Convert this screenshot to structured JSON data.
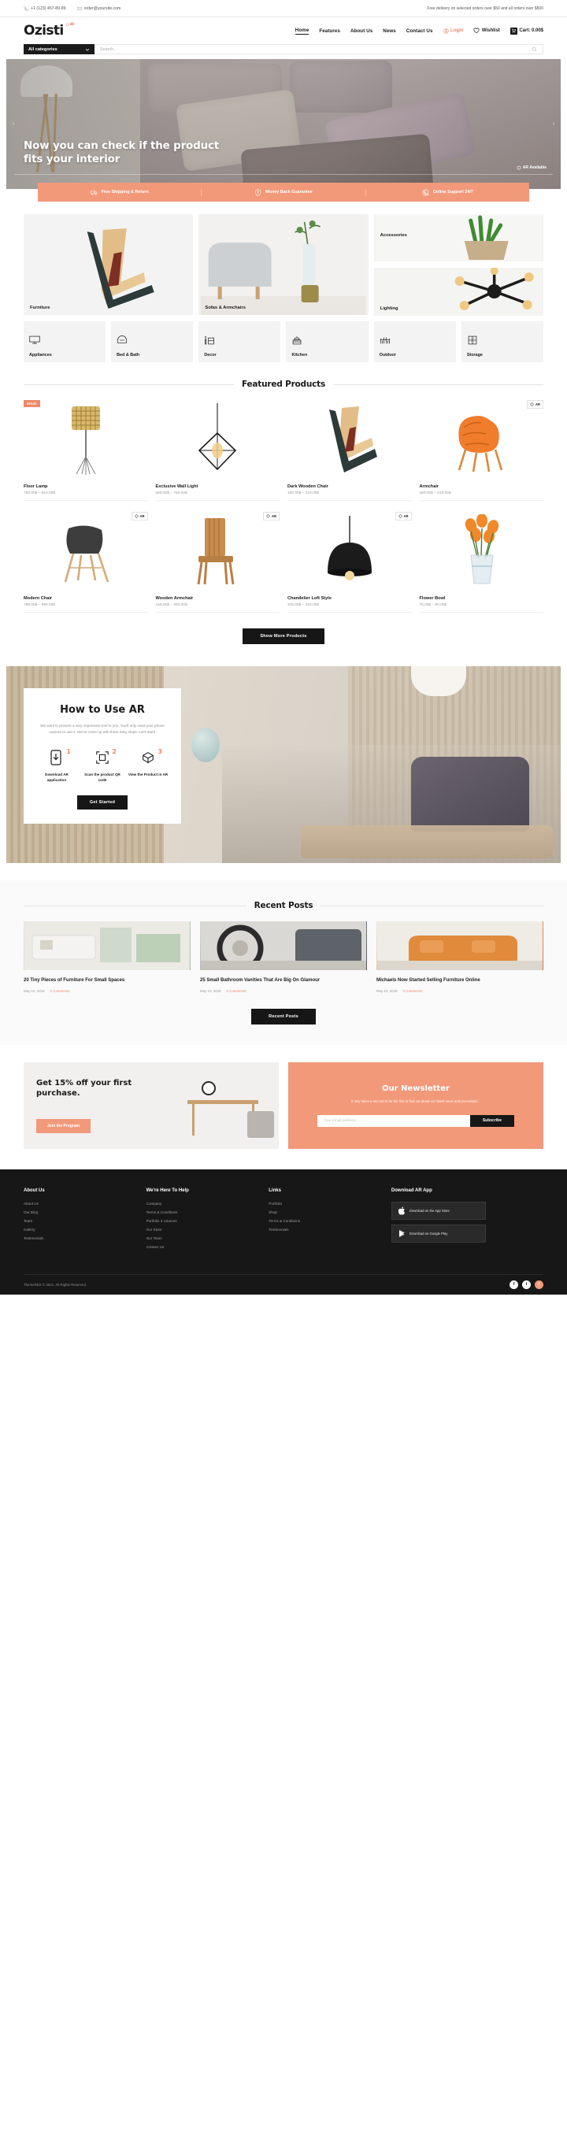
{
  "topbar": {
    "phone": "+1 (123) 457-89-89",
    "email": "order@yoursite.com",
    "notice": "Free delivery on selected orders over $50 and all orders over $500"
  },
  "header": {
    "logo": "Ozisti",
    "logo_badge": "AR",
    "nav": [
      {
        "label": "Home",
        "active": true
      },
      {
        "label": "Features",
        "active": false
      },
      {
        "label": "About Us",
        "active": false
      },
      {
        "label": "News",
        "active": false
      },
      {
        "label": "Contact Us",
        "active": false
      }
    ],
    "login": "Login",
    "wishlist": "Wishlist",
    "cart": "Cart: 0.00$"
  },
  "search": {
    "category": "All categories",
    "placeholder": "Search..."
  },
  "hero": {
    "title_line1": "Now you can check if the product",
    "title_line2": "fits your interior",
    "ar_available": "AR Available"
  },
  "features": [
    {
      "label": "Free Shipping & Return",
      "icon": "truck-icon"
    },
    {
      "label": "Money Back Guarantee",
      "icon": "shield-dollar-icon"
    },
    {
      "label": "Online Support 24/7",
      "icon": "headset-icon"
    }
  ],
  "categories": {
    "large": [
      {
        "label": "Furniture"
      },
      {
        "label": "Sofas & Armchairs"
      },
      {
        "label": "Accessories"
      },
      {
        "label": "Lighting"
      }
    ],
    "small": [
      {
        "label": "Appliances",
        "icon": "tv-icon"
      },
      {
        "label": "Bed & Bath",
        "icon": "bed-icon"
      },
      {
        "label": "Decor",
        "icon": "decor-icon"
      },
      {
        "label": "Kitchen",
        "icon": "kitchen-icon"
      },
      {
        "label": "Outdoor",
        "icon": "outdoor-icon"
      },
      {
        "label": "Storage",
        "icon": "cabinet-icon"
      }
    ]
  },
  "featured": {
    "title": "Featured Products",
    "more_button": "Show More Products",
    "products": [
      {
        "name": "Floor Lamp",
        "price": "750.00$ – 810.00$",
        "sale": true,
        "ar": false
      },
      {
        "name": "Exclusive Wall Light",
        "price": "659.00$ – 769.00$",
        "sale": false,
        "ar": false
      },
      {
        "name": "Dark Wooden Chair",
        "price": "160.00$ – 219.00$",
        "sale": false,
        "ar": false
      },
      {
        "name": "Armchair",
        "price": "459.00$ – 516.00$",
        "sale": false,
        "ar": true
      },
      {
        "name": "Modern Chair",
        "price": "798.00$ – 898.00$",
        "sale": false,
        "ar": true
      },
      {
        "name": "Wooden Armchair",
        "price": "159.00$ – 300.00$",
        "sale": false,
        "ar": true
      },
      {
        "name": "Chandelier Loft Style",
        "price": "205.00$ – 315.00$",
        "sale": false,
        "ar": true
      },
      {
        "name": "Flower Bowl",
        "price": "75.00$ – 80.00$",
        "sale": false,
        "ar": false
      }
    ]
  },
  "ar_section": {
    "title": "How to Use AR",
    "description": "We want to present a very impressive tool to you. You'll only need your phone camera to use it. We've come up with three easy steps. Let's start!",
    "steps": [
      {
        "number": "1",
        "text": "Download AR application",
        "icon": "download-phone-icon"
      },
      {
        "number": "2",
        "text": "Scan the product QR code",
        "icon": "qr-scan-icon"
      },
      {
        "number": "3",
        "text": "View the Product in AR",
        "icon": "view-ar-icon"
      }
    ],
    "button": "Get Started"
  },
  "posts": {
    "title": "Recent Posts",
    "more_button": "Recent Posts",
    "items": [
      {
        "title": "20 Tiny Pieces of Furniture For Small Spaces",
        "date": "May 10, 2018",
        "comments": "0 Comments"
      },
      {
        "title": "25 Small Bathroom Vanities That Are Big On Glamour",
        "date": "May 10, 2018",
        "comments": "0 Comments"
      },
      {
        "title": "Michaels Now Started Selling Furniture Online",
        "date": "May 10, 2018",
        "comments": "0 Comments"
      }
    ]
  },
  "promo": {
    "title": "Get 15% off your first purchase.",
    "button": "Join the Program"
  },
  "newsletter": {
    "title": "Our Newsletter",
    "description": "It only takes a second to be the first to find out about our latest news and promotions...",
    "placeholder": "Your email address",
    "button": "Subscribe"
  },
  "footer": {
    "columns": [
      {
        "heading": "About Us",
        "links": [
          "About Us",
          "Our Blog",
          "Team",
          "Gallery",
          "Testimonials"
        ]
      },
      {
        "heading": "We're Here To Help",
        "links": [
          "Company",
          "Terms & Conditions",
          "Portfolio 3 columns",
          "Our Store",
          "Our Team",
          "Contact Us"
        ]
      },
      {
        "heading": "Links",
        "links": [
          "Portfolio",
          "Shop",
          "Terms & Conditions",
          "Testimonials"
        ]
      }
    ],
    "app": {
      "heading": "Download AR App",
      "buttons": [
        {
          "label": "Download on the App Store",
          "icon": "apple-icon"
        },
        {
          "label": "Download on Google Play",
          "icon": "google-play-icon"
        }
      ]
    },
    "copyright": "ThemeREX © 2021. All Rights Reserved.",
    "socials": [
      "f",
      "t",
      "i"
    ]
  },
  "colors": {
    "accent": "#f2997a",
    "dark": "#171717",
    "muted": "#9a9a9a"
  }
}
